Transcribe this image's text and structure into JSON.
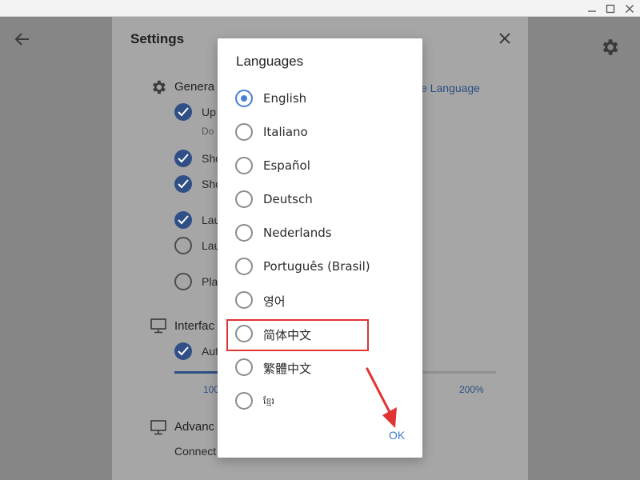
{
  "settings": {
    "title": "Settings",
    "sections": {
      "general": {
        "label": "Genera"
      },
      "interface": {
        "label": "Interfac"
      },
      "advanced": {
        "label": "Advanc",
        "sub": "Connect"
      }
    },
    "change_language_link": "e Language",
    "rows": [
      {
        "text": "Up",
        "checked": true
      },
      {
        "text": "Do",
        "checked": null
      },
      {
        "text": "Sho",
        "checked": true
      },
      {
        "text": "Sho",
        "checked": true
      },
      {
        "text": "Lau",
        "checked": true
      },
      {
        "text": "Lau",
        "checked": false
      },
      {
        "text": "Pla",
        "checked": false
      },
      {
        "text": "Aut",
        "checked": true
      }
    ],
    "zoom_slider": {
      "min_label": "100",
      "max_label": "200%"
    }
  },
  "dialog": {
    "title": "Languages",
    "selected": "English",
    "languages": [
      "English",
      "Italiano",
      "Español",
      "Deutsch",
      "Nederlands",
      "Português (Brasil)",
      "영어",
      "简体中文",
      "繁體中文",
      "ខ្មែរ"
    ],
    "ok_label": "OK"
  },
  "annotation": {
    "highlight_color": "#e03333",
    "highlighted_language": "简体中文"
  },
  "colors": {
    "accent": "#4a7fd4",
    "checkbox_on": "#2f4f86",
    "overlay_bg": "#868686"
  }
}
